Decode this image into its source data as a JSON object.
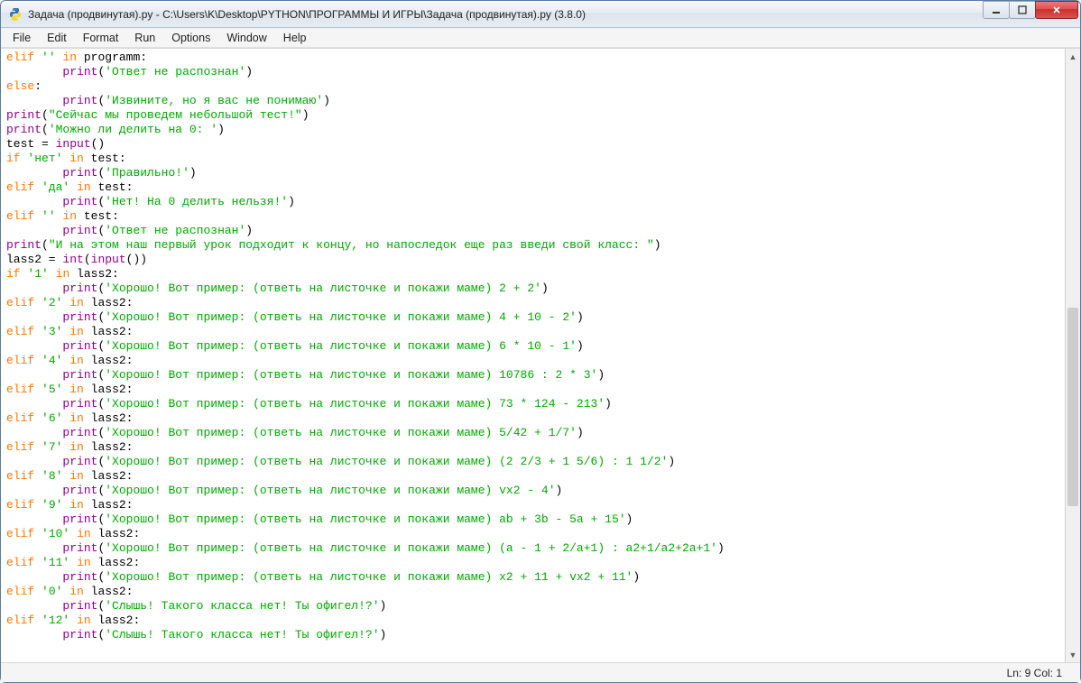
{
  "window": {
    "title": "Задача (продвинутая).py - C:\\Users\\K\\Desktop\\PYTHON\\ПРОГРАММЫ И ИГРЫ\\Задача (продвинутая).py (3.8.0)"
  },
  "menu": {
    "file": "File",
    "edit": "Edit",
    "format": "Format",
    "run": "Run",
    "options": "Options",
    "window": "Window",
    "help": "Help"
  },
  "status": {
    "position": "Ln: 9  Col: 1"
  },
  "code": {
    "lines": [
      {
        "t": [
          [
            "kw",
            "elif"
          ],
          [
            "op",
            " "
          ],
          [
            "str",
            "''"
          ],
          [
            "op",
            " "
          ],
          [
            "kw",
            "in"
          ],
          [
            "op",
            " programm:"
          ]
        ]
      },
      {
        "t": [
          [
            "op",
            "        "
          ],
          [
            "builtin",
            "print"
          ],
          [
            "op",
            "("
          ],
          [
            "str",
            "'Ответ не распознан'"
          ],
          [
            "op",
            ")"
          ]
        ]
      },
      {
        "t": [
          [
            "kw",
            "else"
          ],
          [
            "op",
            ":"
          ]
        ]
      },
      {
        "t": [
          [
            "op",
            "        "
          ],
          [
            "builtin",
            "print"
          ],
          [
            "op",
            "("
          ],
          [
            "str",
            "'Извините, но я вас не понимаю'"
          ],
          [
            "op",
            ")"
          ]
        ]
      },
      {
        "t": [
          [
            "builtin",
            "print"
          ],
          [
            "op",
            "("
          ],
          [
            "str",
            "\"Сейчас мы проведем небольшой тест!\""
          ],
          [
            "op",
            ")"
          ]
        ]
      },
      {
        "t": [
          [
            "builtin",
            "print"
          ],
          [
            "op",
            "("
          ],
          [
            "str",
            "'Можно ли делить на 0: '"
          ],
          [
            "op",
            ")"
          ]
        ]
      },
      {
        "t": [
          [
            "op",
            "test = "
          ],
          [
            "builtin",
            "input"
          ],
          [
            "op",
            "()"
          ]
        ]
      },
      {
        "t": [
          [
            "kw",
            "if"
          ],
          [
            "op",
            " "
          ],
          [
            "str",
            "'нет'"
          ],
          [
            "op",
            " "
          ],
          [
            "kw",
            "in"
          ],
          [
            "op",
            " test:"
          ]
        ]
      },
      {
        "t": [
          [
            "op",
            "        "
          ],
          [
            "builtin",
            "print"
          ],
          [
            "op",
            "("
          ],
          [
            "str",
            "'Правильно!'"
          ],
          [
            "op",
            ")"
          ]
        ]
      },
      {
        "t": [
          [
            "kw",
            "elif"
          ],
          [
            "op",
            " "
          ],
          [
            "str",
            "'да'"
          ],
          [
            "op",
            " "
          ],
          [
            "kw",
            "in"
          ],
          [
            "op",
            " test:"
          ]
        ]
      },
      {
        "t": [
          [
            "op",
            "        "
          ],
          [
            "builtin",
            "print"
          ],
          [
            "op",
            "("
          ],
          [
            "str",
            "'Нет! На 0 делить нельзя!'"
          ],
          [
            "op",
            ")"
          ]
        ]
      },
      {
        "t": [
          [
            "kw",
            "elif"
          ],
          [
            "op",
            " "
          ],
          [
            "str",
            "''"
          ],
          [
            "op",
            " "
          ],
          [
            "kw",
            "in"
          ],
          [
            "op",
            " test:"
          ]
        ]
      },
      {
        "t": [
          [
            "op",
            "        "
          ],
          [
            "builtin",
            "print"
          ],
          [
            "op",
            "("
          ],
          [
            "str",
            "'Ответ не распознан'"
          ],
          [
            "op",
            ")"
          ]
        ]
      },
      {
        "t": [
          [
            "builtin",
            "print"
          ],
          [
            "op",
            "("
          ],
          [
            "str",
            "\"И на этом наш первый урок подходит к концу, но напоследок еще раз введи свой класс: \""
          ],
          [
            "op",
            ")"
          ]
        ]
      },
      {
        "t": [
          [
            "op",
            "lass2 = "
          ],
          [
            "builtin",
            "int"
          ],
          [
            "op",
            "("
          ],
          [
            "builtin",
            "input"
          ],
          [
            "op",
            "())"
          ]
        ]
      },
      {
        "t": [
          [
            "kw",
            "if"
          ],
          [
            "op",
            " "
          ],
          [
            "str",
            "'1'"
          ],
          [
            "op",
            " "
          ],
          [
            "kw",
            "in"
          ],
          [
            "op",
            " lass2:"
          ]
        ]
      },
      {
        "t": [
          [
            "op",
            "        "
          ],
          [
            "builtin",
            "print"
          ],
          [
            "op",
            "("
          ],
          [
            "str",
            "'Хорошо! Вот пример: (ответь на листочке и покажи маме) 2 + 2'"
          ],
          [
            "op",
            ")"
          ]
        ]
      },
      {
        "t": [
          [
            "kw",
            "elif"
          ],
          [
            "op",
            " "
          ],
          [
            "str",
            "'2'"
          ],
          [
            "op",
            " "
          ],
          [
            "kw",
            "in"
          ],
          [
            "op",
            " lass2:"
          ]
        ]
      },
      {
        "t": [
          [
            "op",
            "        "
          ],
          [
            "builtin",
            "print"
          ],
          [
            "op",
            "("
          ],
          [
            "str",
            "'Хорошо! Вот пример: (ответь на листочке и покажи маме) 4 + 10 - 2'"
          ],
          [
            "op",
            ")"
          ]
        ]
      },
      {
        "t": [
          [
            "kw",
            "elif"
          ],
          [
            "op",
            " "
          ],
          [
            "str",
            "'3'"
          ],
          [
            "op",
            " "
          ],
          [
            "kw",
            "in"
          ],
          [
            "op",
            " lass2:"
          ]
        ]
      },
      {
        "t": [
          [
            "op",
            "        "
          ],
          [
            "builtin",
            "print"
          ],
          [
            "op",
            "("
          ],
          [
            "str",
            "'Хорошо! Вот пример: (ответь на листочке и покажи маме) 6 * 10 - 1'"
          ],
          [
            "op",
            ")"
          ]
        ]
      },
      {
        "t": [
          [
            "kw",
            "elif"
          ],
          [
            "op",
            " "
          ],
          [
            "str",
            "'4'"
          ],
          [
            "op",
            " "
          ],
          [
            "kw",
            "in"
          ],
          [
            "op",
            " lass2:"
          ]
        ]
      },
      {
        "t": [
          [
            "op",
            "        "
          ],
          [
            "builtin",
            "print"
          ],
          [
            "op",
            "("
          ],
          [
            "str",
            "'Хорошо! Вот пример: (ответь на листочке и покажи маме) 10786 : 2 * 3'"
          ],
          [
            "op",
            ")"
          ]
        ]
      },
      {
        "t": [
          [
            "kw",
            "elif"
          ],
          [
            "op",
            " "
          ],
          [
            "str",
            "'5'"
          ],
          [
            "op",
            " "
          ],
          [
            "kw",
            "in"
          ],
          [
            "op",
            " lass2:"
          ]
        ]
      },
      {
        "t": [
          [
            "op",
            "        "
          ],
          [
            "builtin",
            "print"
          ],
          [
            "op",
            "("
          ],
          [
            "str",
            "'Хорошо! Вот пример: (ответь на листочке и покажи маме) 73 * 124 - 213'"
          ],
          [
            "op",
            ")"
          ]
        ]
      },
      {
        "t": [
          [
            "kw",
            "elif"
          ],
          [
            "op",
            " "
          ],
          [
            "str",
            "'6'"
          ],
          [
            "op",
            " "
          ],
          [
            "kw",
            "in"
          ],
          [
            "op",
            " lass2:"
          ]
        ]
      },
      {
        "t": [
          [
            "op",
            "        "
          ],
          [
            "builtin",
            "print"
          ],
          [
            "op",
            "("
          ],
          [
            "str",
            "'Хорошо! Вот пример: (ответь на листочке и покажи маме) 5/42 + 1/7'"
          ],
          [
            "op",
            ")"
          ]
        ]
      },
      {
        "t": [
          [
            "kw",
            "elif"
          ],
          [
            "op",
            " "
          ],
          [
            "str",
            "'7'"
          ],
          [
            "op",
            " "
          ],
          [
            "kw",
            "in"
          ],
          [
            "op",
            " lass2:"
          ]
        ]
      },
      {
        "t": [
          [
            "op",
            "        "
          ],
          [
            "builtin",
            "print"
          ],
          [
            "op",
            "("
          ],
          [
            "str",
            "'Хорошо! Вот пример: (ответь на листочке и покажи маме) (2 2/3 + 1 5/6) : 1 1/2'"
          ],
          [
            "op",
            ")"
          ]
        ]
      },
      {
        "t": [
          [
            "kw",
            "elif"
          ],
          [
            "op",
            " "
          ],
          [
            "str",
            "'8'"
          ],
          [
            "op",
            " "
          ],
          [
            "kw",
            "in"
          ],
          [
            "op",
            " lass2:"
          ]
        ]
      },
      {
        "t": [
          [
            "op",
            "        "
          ],
          [
            "builtin",
            "print"
          ],
          [
            "op",
            "("
          ],
          [
            "str",
            "'Хорошо! Вот пример: (ответь на листочке и покажи маме) vx2 - 4'"
          ],
          [
            "op",
            ")"
          ]
        ]
      },
      {
        "t": [
          [
            "kw",
            "elif"
          ],
          [
            "op",
            " "
          ],
          [
            "str",
            "'9'"
          ],
          [
            "op",
            " "
          ],
          [
            "kw",
            "in"
          ],
          [
            "op",
            " lass2:"
          ]
        ]
      },
      {
        "t": [
          [
            "op",
            "        "
          ],
          [
            "builtin",
            "print"
          ],
          [
            "op",
            "("
          ],
          [
            "str",
            "'Хорошо! Вот пример: (ответь на листочке и покажи маме) ab + 3b - 5a + 15'"
          ],
          [
            "op",
            ")"
          ]
        ]
      },
      {
        "t": [
          [
            "kw",
            "elif"
          ],
          [
            "op",
            " "
          ],
          [
            "str",
            "'10'"
          ],
          [
            "op",
            " "
          ],
          [
            "kw",
            "in"
          ],
          [
            "op",
            " lass2:"
          ]
        ]
      },
      {
        "t": [
          [
            "op",
            "        "
          ],
          [
            "builtin",
            "print"
          ],
          [
            "op",
            "("
          ],
          [
            "str",
            "'Хорошо! Вот пример: (ответь на листочке и покажи маме) (a - 1 + 2/a+1) : a2+1/a2+2a+1'"
          ],
          [
            "op",
            ")"
          ]
        ]
      },
      {
        "t": [
          [
            "kw",
            "elif"
          ],
          [
            "op",
            " "
          ],
          [
            "str",
            "'11'"
          ],
          [
            "op",
            " "
          ],
          [
            "kw",
            "in"
          ],
          [
            "op",
            " lass2:"
          ]
        ]
      },
      {
        "t": [
          [
            "op",
            "        "
          ],
          [
            "builtin",
            "print"
          ],
          [
            "op",
            "("
          ],
          [
            "str",
            "'Хорошо! Вот пример: (ответь на листочке и покажи маме) x2 + 11 + vx2 + 11'"
          ],
          [
            "op",
            ")"
          ]
        ]
      },
      {
        "t": [
          [
            "kw",
            "elif"
          ],
          [
            "op",
            " "
          ],
          [
            "str",
            "'0'"
          ],
          [
            "op",
            " "
          ],
          [
            "kw",
            "in"
          ],
          [
            "op",
            " lass2:"
          ]
        ]
      },
      {
        "t": [
          [
            "op",
            "        "
          ],
          [
            "builtin",
            "print"
          ],
          [
            "op",
            "("
          ],
          [
            "str",
            "'Слышь! Такого класса нет! Ты офигел!?'"
          ],
          [
            "op",
            ")"
          ]
        ]
      },
      {
        "t": [
          [
            "kw",
            "elif"
          ],
          [
            "op",
            " "
          ],
          [
            "str",
            "'12'"
          ],
          [
            "op",
            " "
          ],
          [
            "kw",
            "in"
          ],
          [
            "op",
            " lass2:"
          ]
        ]
      },
      {
        "t": [
          [
            "op",
            "        "
          ],
          [
            "builtin",
            "print"
          ],
          [
            "op",
            "("
          ],
          [
            "str",
            "'Слышь! Такого класса нет! Ты офигел!?'"
          ],
          [
            "op",
            ")"
          ]
        ]
      }
    ]
  }
}
